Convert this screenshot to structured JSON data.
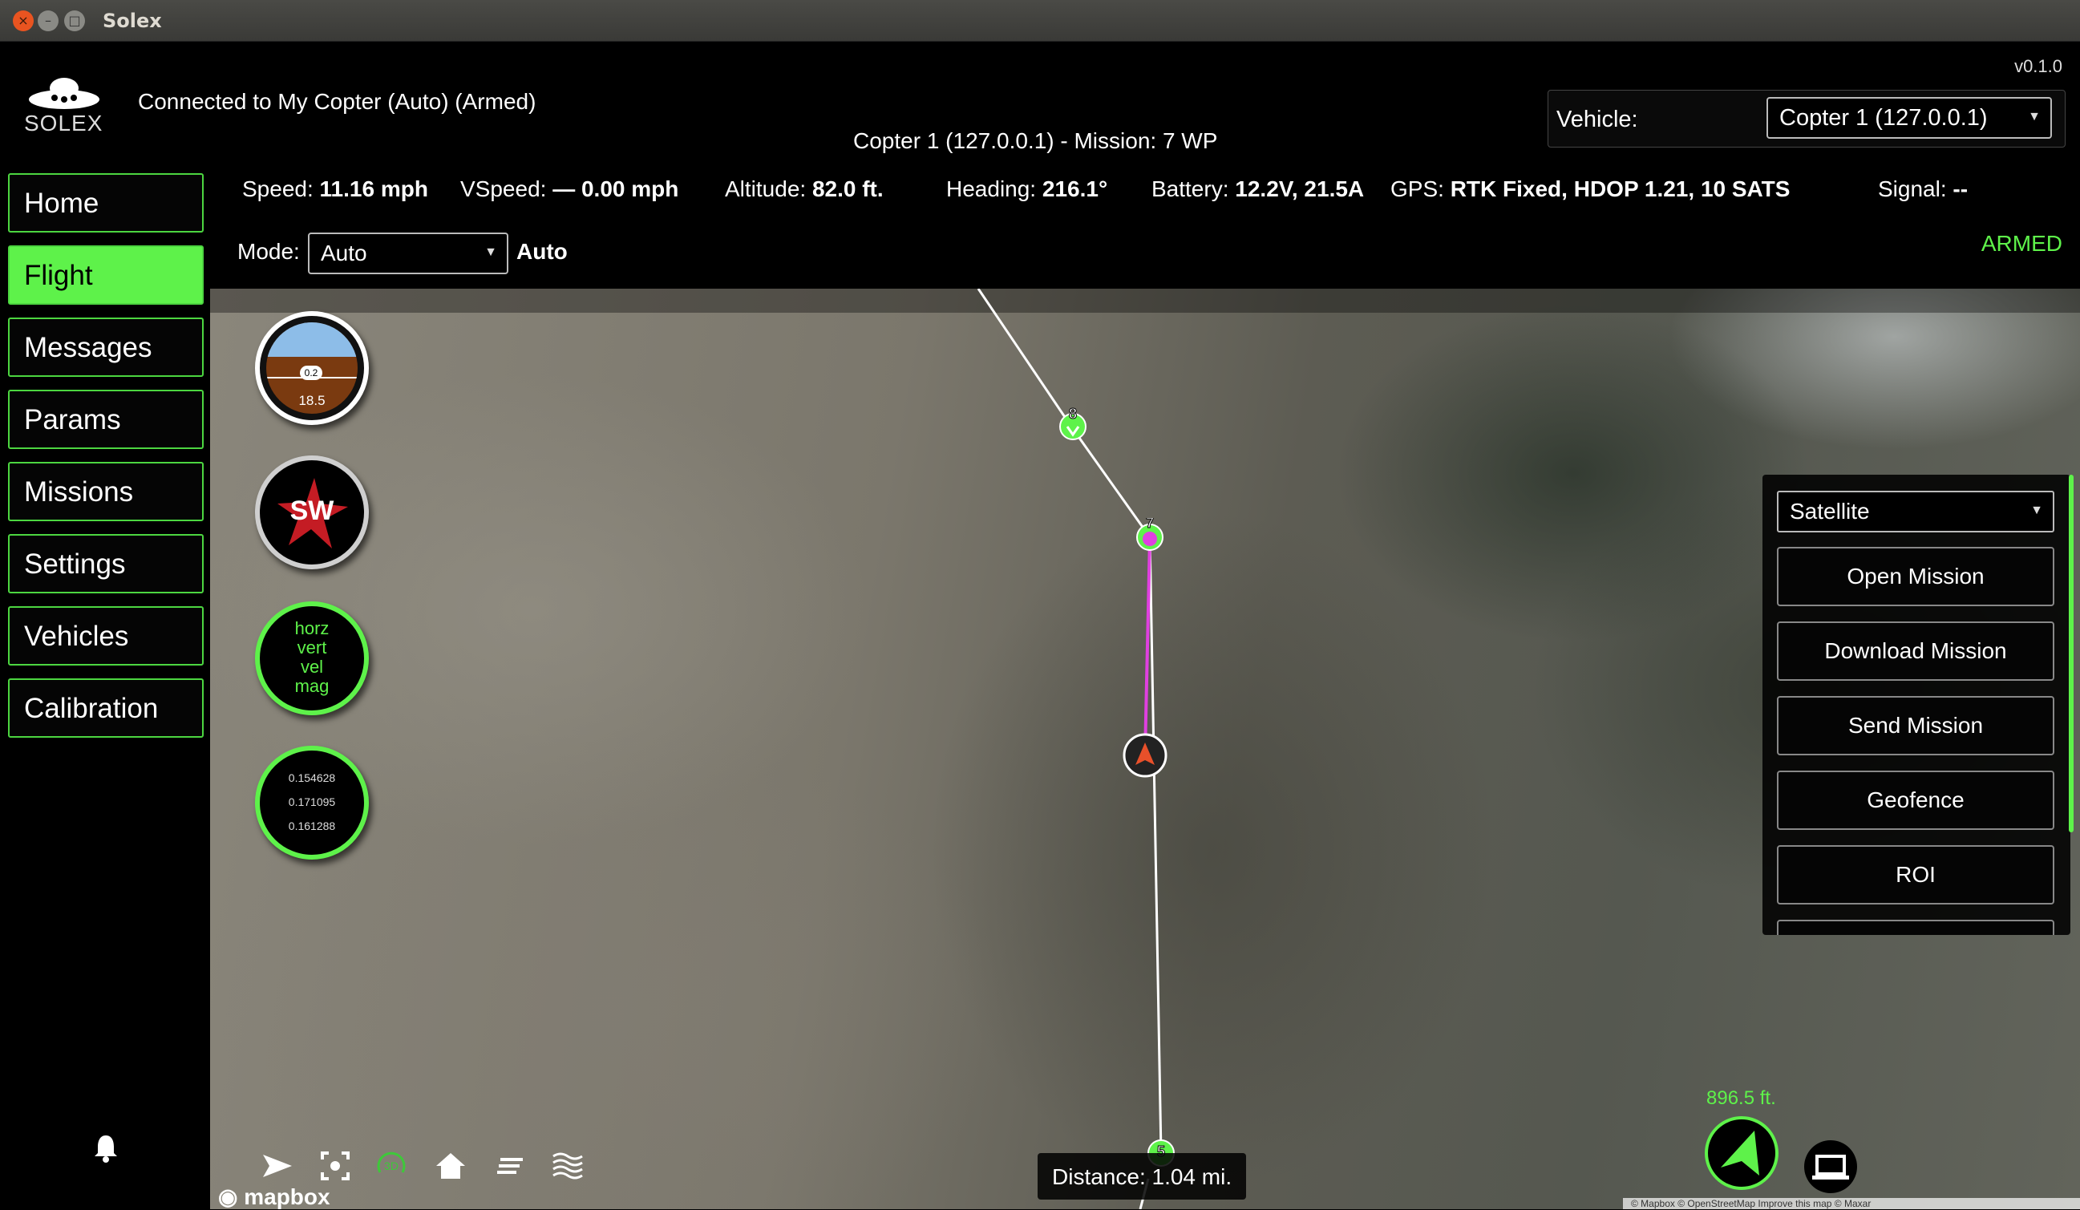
{
  "window": {
    "title": "Solex",
    "close": "×",
    "minimize": "–",
    "maximize": "□"
  },
  "app": {
    "logo_text": "SOLEX",
    "version": "v0.1.0",
    "connection": "Connected to My Copter (Auto) (Armed)",
    "mission_line": "Copter 1 (127.0.0.1) - Mission: 7 WP"
  },
  "vehicle": {
    "label": "Vehicle:",
    "selected": "Copter 1 (127.0.0.1)"
  },
  "telemetry": {
    "speed_label": "Speed:",
    "speed": "11.16 mph",
    "vspeed_label": "VSpeed:",
    "vspeed": "— 0.00 mph",
    "altitude_label": "Altitude:",
    "altitude": "82.0 ft.",
    "heading_label": "Heading:",
    "heading": "216.1°",
    "battery_label": "Battery:",
    "battery": "12.2V, 21.5A",
    "gps_label": "GPS:",
    "gps": "RTK Fixed, HDOP 1.21, 10 SATS",
    "signal_label": "Signal:",
    "signal": "--"
  },
  "mode": {
    "label": "Mode:",
    "selected": "Auto",
    "value": "Auto"
  },
  "armed_status": "ARMED",
  "sidebar": {
    "items": [
      {
        "label": "Home"
      },
      {
        "label": "Flight"
      },
      {
        "label": "Messages"
      },
      {
        "label": "Params"
      },
      {
        "label": "Missions"
      },
      {
        "label": "Settings"
      },
      {
        "label": "Vehicles"
      },
      {
        "label": "Calibration"
      }
    ],
    "active": "Flight"
  },
  "gauges": {
    "attitude_pill": "0.2",
    "attitude_alt": "18.5",
    "compass": "SW",
    "ekf": [
      "horz",
      "vert",
      "vel",
      "mag"
    ],
    "vibration": [
      "0.154628",
      "0.171095",
      "0.161288"
    ]
  },
  "map_panel": {
    "map_type": "Satellite",
    "buttons": [
      "Open Mission",
      "Download Mission",
      "Send Mission",
      "Geofence",
      "ROI"
    ]
  },
  "waypoints": [
    "8",
    "7",
    "5"
  ],
  "distance": "Distance: 1.04 mi.",
  "altitude_readout": "896.5 ft.",
  "mapbox_logo": "mapbox",
  "attribution": "© Mapbox © OpenStreetMap Improve this map © Maxar",
  "colors": {
    "accent": "#5ef24a",
    "mission_active": "#e040e0"
  }
}
